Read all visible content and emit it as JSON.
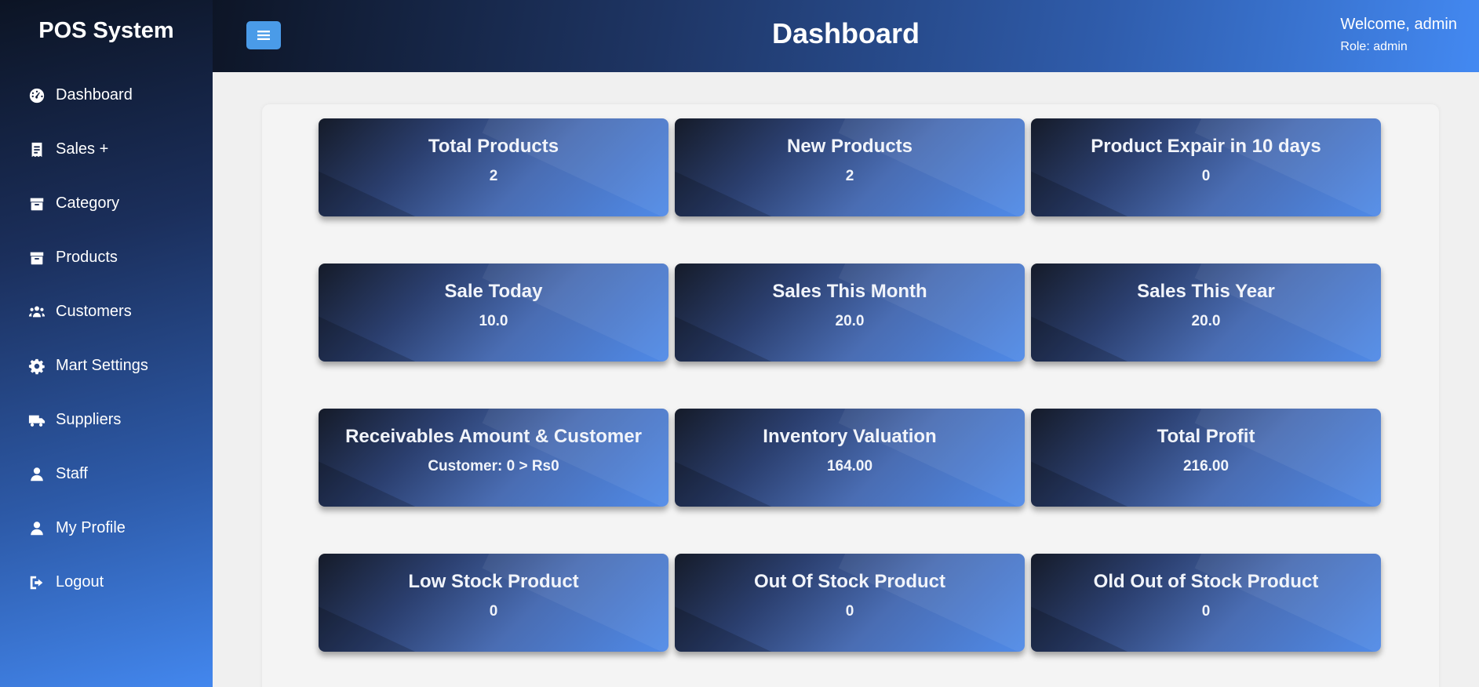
{
  "sidebar": {
    "brand": "POS System",
    "items": [
      {
        "label": "Dashboard",
        "icon": "gauge-icon"
      },
      {
        "label": "Sales +",
        "icon": "receipt-icon"
      },
      {
        "label": "Category",
        "icon": "box-icon"
      },
      {
        "label": "Products",
        "icon": "box-icon"
      },
      {
        "label": "Customers",
        "icon": "users-icon"
      },
      {
        "label": "Mart Settings",
        "icon": "gear-icon"
      },
      {
        "label": "Suppliers",
        "icon": "truck-icon"
      },
      {
        "label": "Staff",
        "icon": "user-icon"
      },
      {
        "label": "My Profile",
        "icon": "user-icon"
      },
      {
        "label": "Logout",
        "icon": "logout-icon"
      }
    ]
  },
  "header": {
    "menu_icon": "hamburger-icon",
    "title": "Dashboard",
    "welcome": "Welcome, admin",
    "role": "Role: admin"
  },
  "cards": [
    {
      "title": "Total Products",
      "value": "2"
    },
    {
      "title": "New Products",
      "value": "2"
    },
    {
      "title": "Product Expair in 10 days",
      "value": "0"
    },
    {
      "title": "Sale Today",
      "value": "10.0"
    },
    {
      "title": "Sales This Month",
      "value": "20.0"
    },
    {
      "title": "Sales This Year",
      "value": "20.0"
    },
    {
      "title": "Receivables Amount & Customer",
      "value": "Customer: 0 > Rs0"
    },
    {
      "title": "Inventory Valuation",
      "value": "164.00"
    },
    {
      "title": "Total Profit",
      "value": "216.00"
    },
    {
      "title": "Low Stock Product",
      "value": "0"
    },
    {
      "title": "Out Of Stock Product",
      "value": "0"
    },
    {
      "title": "Old Out of Stock Product",
      "value": "0"
    }
  ],
  "colors": {
    "menu_button": "#4a9be8",
    "accent_blue": "#4387ee",
    "dark_navy": "#0c1424"
  }
}
